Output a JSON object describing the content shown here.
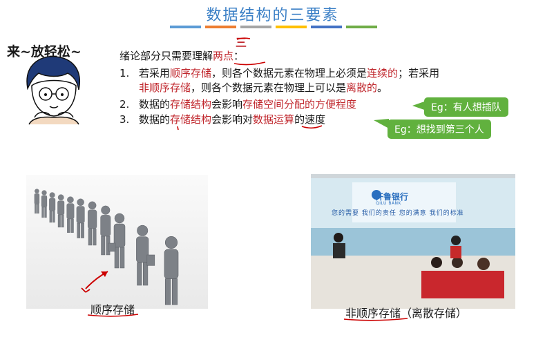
{
  "watermark": "",
  "slide": {
    "title": "数据结构的三要素",
    "color_bars": [
      "#5b9bd5",
      "#ed7d31",
      "#a5a5a5",
      "#ffc000",
      "#4472c4",
      "#70ad47"
    ],
    "annotation_mark": "三",
    "cartoon_caption": "来~放轻松~",
    "intro": {
      "prefix": "绪论部分只需要理解",
      "highlight": "两点",
      "suffix": "："
    },
    "points": [
      {
        "num": "1.",
        "line1": [
          {
            "t": "若采用",
            "c": ""
          },
          {
            "t": "顺序存储",
            "c": "red"
          },
          {
            "t": "，则各个数据元素在物理上必须是",
            "c": ""
          },
          {
            "t": "连续的",
            "c": "red"
          },
          {
            "t": "；若采用",
            "c": ""
          }
        ],
        "line2": [
          {
            "t": "非顺序存储",
            "c": "red"
          },
          {
            "t": "，则各个数据元素在物理上可以是",
            "c": ""
          },
          {
            "t": "离散的",
            "c": "red"
          },
          {
            "t": "。",
            "c": ""
          }
        ]
      },
      {
        "num": "2.",
        "line1": [
          {
            "t": "数据的",
            "c": ""
          },
          {
            "t": "存储结构",
            "c": "red"
          },
          {
            "t": "会影响",
            "c": ""
          },
          {
            "t": "存储空间分配的方便程度",
            "c": "red"
          }
        ]
      },
      {
        "num": "3.",
        "line1": [
          {
            "t": "数据的",
            "c": ""
          },
          {
            "t": "存储结构",
            "c": "red"
          },
          {
            "t": "会影响对",
            "c": ""
          },
          {
            "t": "数据运算",
            "c": "red"
          },
          {
            "t": "的速度",
            "c": ""
          }
        ]
      }
    ],
    "callouts": [
      "Eg：有人想插队",
      "Eg：想找到第三个人"
    ],
    "bank": {
      "name_cn": "齐鲁银行",
      "name_en": "QILU BANK",
      "slogan": "您的需要 我们的责任 您的满意 我们的标准"
    },
    "left_image_caption": "顺序存储",
    "right_image_caption": "非顺序存储（离散存储）"
  }
}
